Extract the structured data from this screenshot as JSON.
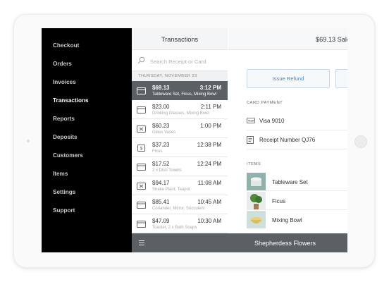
{
  "nav": {
    "items": [
      {
        "label": "Checkout"
      },
      {
        "label": "Orders"
      },
      {
        "label": "Invoices"
      },
      {
        "label": "Transactions",
        "active": true
      },
      {
        "label": "Reports"
      },
      {
        "label": "Deposits"
      },
      {
        "label": "Customers"
      },
      {
        "label": "Items"
      },
      {
        "label": "Settings"
      },
      {
        "label": "Support"
      }
    ]
  },
  "list": {
    "title": "Transactions",
    "search_placeholder": "Search Receipt or Card",
    "date_separator": "THURSDAY, NOVEMBER 23",
    "transactions": [
      {
        "amount": "$69.13",
        "time": "3:12 PM",
        "desc": "Tableware Set, Ficus, Mixing Bowl",
        "icon": "card-icon",
        "selected": true
      },
      {
        "amount": "$23.00",
        "time": "2:11 PM",
        "desc": "Drinking Glasses, Mixing Bowl",
        "icon": "card-icon"
      },
      {
        "amount": "$60.23",
        "time": "1:00 PM",
        "desc": "Glass Vases",
        "icon": "gift-card-icon"
      },
      {
        "amount": "$37.23",
        "time": "12:38 PM",
        "desc": "Ficus",
        "icon": "cash-icon"
      },
      {
        "amount": "$17.52",
        "time": "12:24 PM",
        "desc": "2 x Dish Towels",
        "icon": "card-icon"
      },
      {
        "amount": "$94.17",
        "time": "11:08 AM",
        "desc": "Snake Plant, Teapot",
        "icon": "gift-card-icon"
      },
      {
        "amount": "$85.41",
        "time": "10:45 AM",
        "desc": "Coriander, Mirror, Succulent",
        "icon": "card-icon"
      },
      {
        "amount": "$47.09",
        "time": "10:30 AM",
        "desc": "Toaster, 2 x Bath Soaps",
        "icon": "card-icon"
      }
    ]
  },
  "detail": {
    "title": "$69.13 Sale",
    "refund_label": "Issue Refund",
    "card_payment_label": "CARD PAYMENT",
    "card_brand": "VISA",
    "card_text": "Visa 9010",
    "receipt_text": "Receipt Number QJ76",
    "items_label": "ITEMS",
    "items": [
      {
        "name": "Tableware Set"
      },
      {
        "name": "Ficus"
      },
      {
        "name": "Mixing Bowl"
      }
    ]
  },
  "footer": {
    "shop_name": "Shepherdess Flowers"
  },
  "colors": {
    "nav_bg": "#000000",
    "selected_row": "#5b6065",
    "accent_blue": "#3a86c8",
    "footer_bg": "#5b6065"
  }
}
